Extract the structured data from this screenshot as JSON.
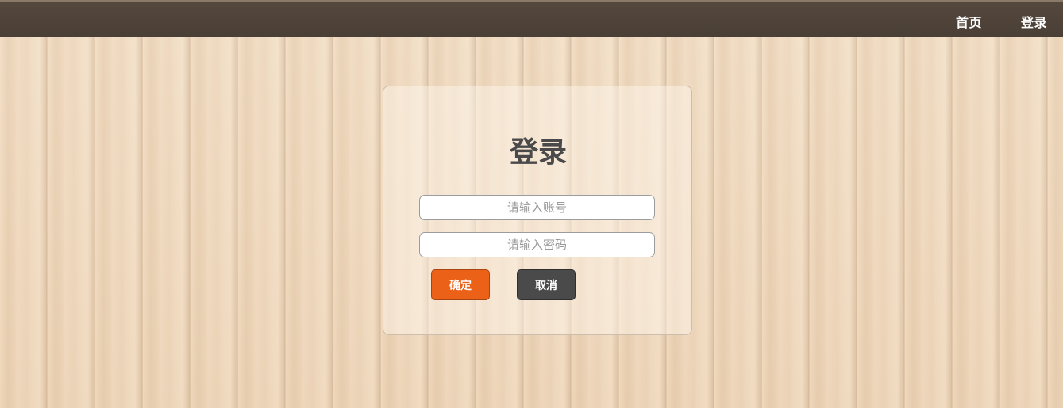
{
  "nav": {
    "home_label": "首页",
    "login_label": "登录"
  },
  "login_form": {
    "title": "登录",
    "account_placeholder": "请输入账号",
    "password_placeholder": "请输入密码",
    "confirm_label": "确定",
    "cancel_label": "取消"
  },
  "colors": {
    "topbar": "#4a3f36",
    "confirm_button": "#ec6118",
    "cancel_button": "#4a4a4a",
    "title_text": "#4a4a4a"
  }
}
